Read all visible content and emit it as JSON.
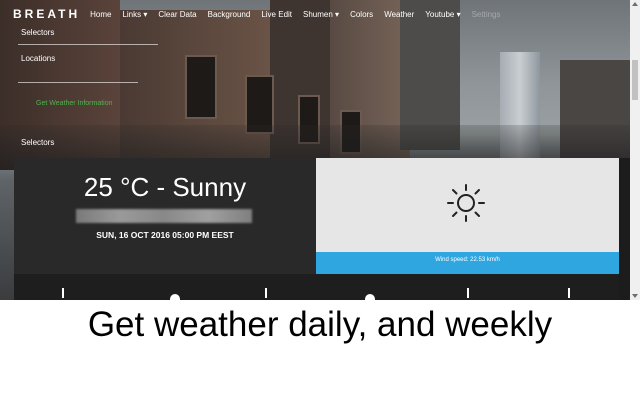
{
  "app": {
    "logo": "BREATH"
  },
  "nav": {
    "items": [
      {
        "label": "Home"
      },
      {
        "label": "Links ▾"
      },
      {
        "label": "Clear Data"
      },
      {
        "label": "Background"
      },
      {
        "label": "Live Edit"
      },
      {
        "label": "Shumen ▾"
      },
      {
        "label": "Colors"
      },
      {
        "label": "Weather"
      },
      {
        "label": "Youtube ▾"
      },
      {
        "label": "Settings"
      }
    ]
  },
  "side_panel": {
    "selectors_top": "Selectors",
    "locations": "Locations",
    "green_text": "Get Weather Information",
    "selectors_bottom": "Selectors"
  },
  "weather": {
    "temperature_condition": "25 °C - Sunny",
    "datetime": "SUN, 16 OCT 2016 05:00 PM EEST",
    "icon": "sun-icon",
    "wind_speed": "Wind speed: 22.53 km/h"
  },
  "caption": "Get weather daily, and weekly",
  "colors": {
    "wind_bar": "#2fa6e0",
    "card_dark": "#292929",
    "card_light": "#e6e6e6",
    "green_text": "#4fb24f"
  }
}
